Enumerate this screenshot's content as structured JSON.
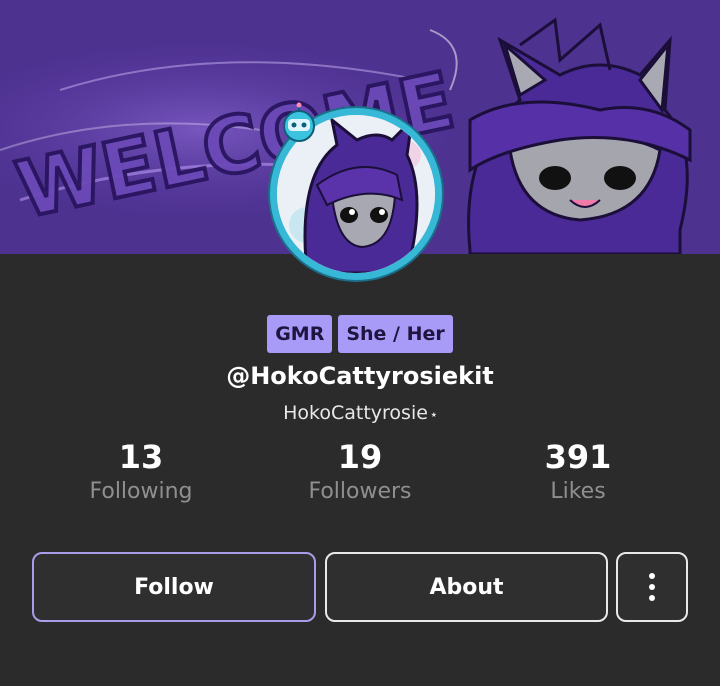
{
  "banner": {
    "welcome_text": "WELCOME"
  },
  "profile": {
    "badges": [
      "GMR",
      "She / Her"
    ],
    "handle": "@HokoCattyrosiekit",
    "display_name": "HokoCattyrosie",
    "verified_glyph": "⭑"
  },
  "stats": [
    {
      "value": "13",
      "label": "Following"
    },
    {
      "value": "19",
      "label": "Followers"
    },
    {
      "value": "391",
      "label": "Likes"
    }
  ],
  "actions": {
    "follow_label": "Follow",
    "about_label": "About",
    "more_icon": "more-vertical-icon"
  },
  "colors": {
    "background": "#2b2b2b",
    "badge_bg": "#a79bf7",
    "follow_border": "#a99ce8",
    "avatar_ring": "#37b8d6",
    "banner_purple": "#4c2f8a"
  }
}
